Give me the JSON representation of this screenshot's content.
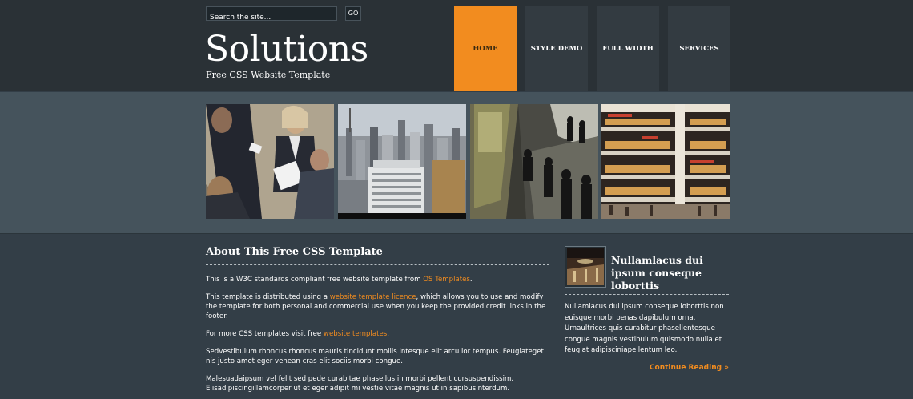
{
  "search": {
    "placeholder": "Search the site...",
    "go_label": "GO"
  },
  "header": {
    "logo": "Solutions",
    "tagline": "Free CSS Website Template"
  },
  "nav": {
    "items": [
      {
        "label": "Home"
      },
      {
        "label": "Style Demo"
      },
      {
        "label": "Full Width"
      },
      {
        "label": "Services"
      }
    ],
    "active_color": "#f28c1f"
  },
  "content": {
    "title": "About This Free CSS Template",
    "p1_before": "This is a W3C standards compliant free website template from ",
    "p1_link": "OS Templates",
    "p1_after": ".",
    "p2_before": "This template is distributed using a ",
    "p2_link": "website template licence",
    "p2_after": ", which allows you to use and modify the template for both personal and commercial use when you keep the provided credit links in the footer.",
    "p3_before": "For more CSS templates visit free ",
    "p3_link": "website templates",
    "p3_after": ".",
    "p4": "Sedvestibulum rhoncus rhoncus mauris tincidunt mollis intesque elit arcu lor tempus. Feugiateget nis justo amet eger venean cras elit sociis morbi congue.",
    "p5": "Malesuadaipsum vel felit sed pede curabitae phasellus in morbi pellent cursuspendissim. Elisadipiscingillamcorper ut et eger adipit mi vestie vitae magnis ut in sapibusinterdum."
  },
  "sidebar": {
    "title": "Nullamlacus dui ipsum conseque loborttis",
    "text": "Nullamlacus dui ipsum conseque loborttis non euisque morbi penas dapibulum orna. Urnaultrices quis curabitur phasellentesque congue magnis vestibulum quismodo nulla et feugiat adipisciniapellentum leo.",
    "continue": "Continue Reading »"
  },
  "colors": {
    "accent": "#f28c1f",
    "header_bg": "#2a3136",
    "body_bg": "#333e47",
    "gallery_bg": "#45535c"
  },
  "gallery": {
    "photos": [
      "business-meeting-photo",
      "city-skyline-photo",
      "train-platform-photo",
      "shopping-mall-photo"
    ]
  }
}
